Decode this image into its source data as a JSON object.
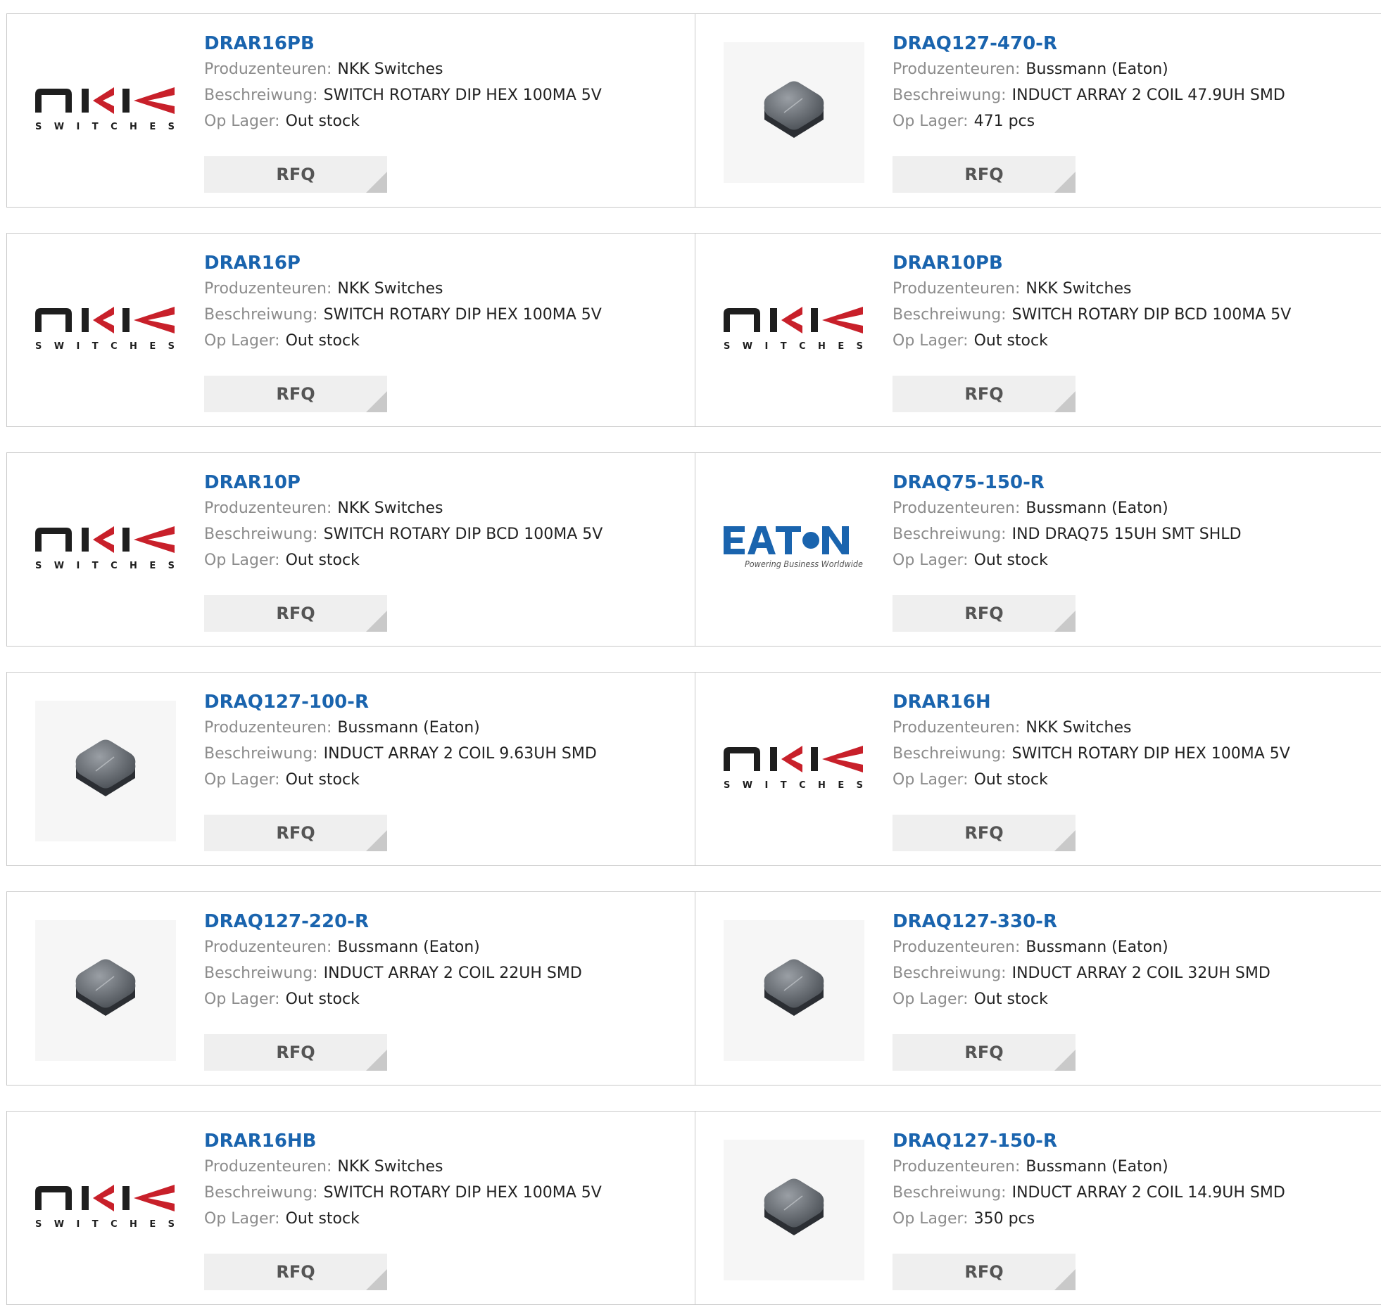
{
  "labels": {
    "manufacturer": "Produzenteuren:",
    "description": "Beschreiwung:",
    "stock": "Op Lager:",
    "rfq": "RFQ"
  },
  "logos": {
    "nkk": {
      "name": "NKK",
      "tagline": "SWITCHES"
    },
    "eaton": {
      "name": "EATON",
      "tagline": "Powering Business Worldwide",
      "color": "#1a64ae"
    }
  },
  "products": [
    {
      "part": "DRAR16PB",
      "manufacturer": "NKK Switches",
      "description": "SWITCH ROTARY DIP HEX 100MA 5V",
      "stock": "Out stock",
      "image": "nkk-logo"
    },
    {
      "part": "DRAQ127-470-R",
      "manufacturer": "Bussmann (Eaton)",
      "description": "INDUCT ARRAY 2 COIL 47.9UH SMD",
      "stock": "471 pcs",
      "image": "inductor-chip"
    },
    {
      "part": "DRAR16P",
      "manufacturer": "NKK Switches",
      "description": "SWITCH ROTARY DIP HEX 100MA 5V",
      "stock": "Out stock",
      "image": "nkk-logo"
    },
    {
      "part": "DRAR10PB",
      "manufacturer": "NKK Switches",
      "description": "SWITCH ROTARY DIP BCD 100MA 5V",
      "stock": "Out stock",
      "image": "nkk-logo"
    },
    {
      "part": "DRAR10P",
      "manufacturer": "NKK Switches",
      "description": "SWITCH ROTARY DIP BCD 100MA 5V",
      "stock": "Out stock",
      "image": "nkk-logo"
    },
    {
      "part": "DRAQ75-150-R",
      "manufacturer": "Bussmann (Eaton)",
      "description": "IND DRAQ75 15UH SMT SHLD",
      "stock": "Out stock",
      "image": "eaton-logo"
    },
    {
      "part": "DRAQ127-100-R",
      "manufacturer": "Bussmann (Eaton)",
      "description": "INDUCT ARRAY 2 COIL 9.63UH SMD",
      "stock": "Out stock",
      "image": "inductor-chip"
    },
    {
      "part": "DRAR16H",
      "manufacturer": "NKK Switches",
      "description": "SWITCH ROTARY DIP HEX 100MA 5V",
      "stock": "Out stock",
      "image": "nkk-logo"
    },
    {
      "part": "DRAQ127-220-R",
      "manufacturer": "Bussmann (Eaton)",
      "description": "INDUCT ARRAY 2 COIL 22UH SMD",
      "stock": "Out stock",
      "image": "inductor-chip"
    },
    {
      "part": "DRAQ127-330-R",
      "manufacturer": "Bussmann (Eaton)",
      "description": "INDUCT ARRAY 2 COIL 32UH SMD",
      "stock": "Out stock",
      "image": "inductor-chip"
    },
    {
      "part": "DRAR16HB",
      "manufacturer": "NKK Switches",
      "description": "SWITCH ROTARY DIP HEX 100MA 5V",
      "stock": "Out stock",
      "image": "nkk-logo"
    },
    {
      "part": "DRAQ127-150-R",
      "manufacturer": "Bussmann (Eaton)",
      "description": "INDUCT ARRAY 2 COIL 14.9UH SMD",
      "stock": "350 pcs",
      "image": "inductor-chip"
    }
  ]
}
